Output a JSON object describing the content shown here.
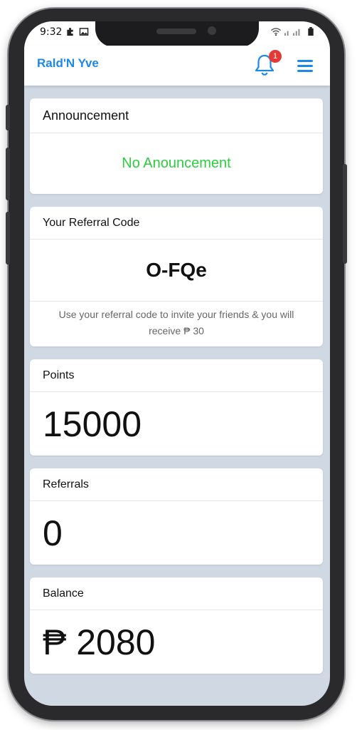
{
  "status": {
    "time": "9:32"
  },
  "app": {
    "title": "Rald'N Yve",
    "notification_count": "1"
  },
  "announcement": {
    "title": "Announcement",
    "message": "No Anouncement"
  },
  "referral": {
    "title": "Your Referral Code",
    "code": "O-FQe",
    "info_line1": "Use your referral code to invite your friends & you will",
    "info_line2": "receive  ₱ 30"
  },
  "points": {
    "title": "Points",
    "value": "15000"
  },
  "referrals": {
    "title": "Referrals",
    "value": "0"
  },
  "balance": {
    "title": "Balance",
    "value": "₱ 2080"
  },
  "colors": {
    "accent": "#1e88e5",
    "success": "#2ecc40",
    "badge": "#e53935",
    "background": "#cfd8e3"
  },
  "icons": [
    "puzzle-icon",
    "image-icon",
    "wifi-icon",
    "signal-icon",
    "battery-icon",
    "bell-icon",
    "hamburger-menu-icon"
  ]
}
